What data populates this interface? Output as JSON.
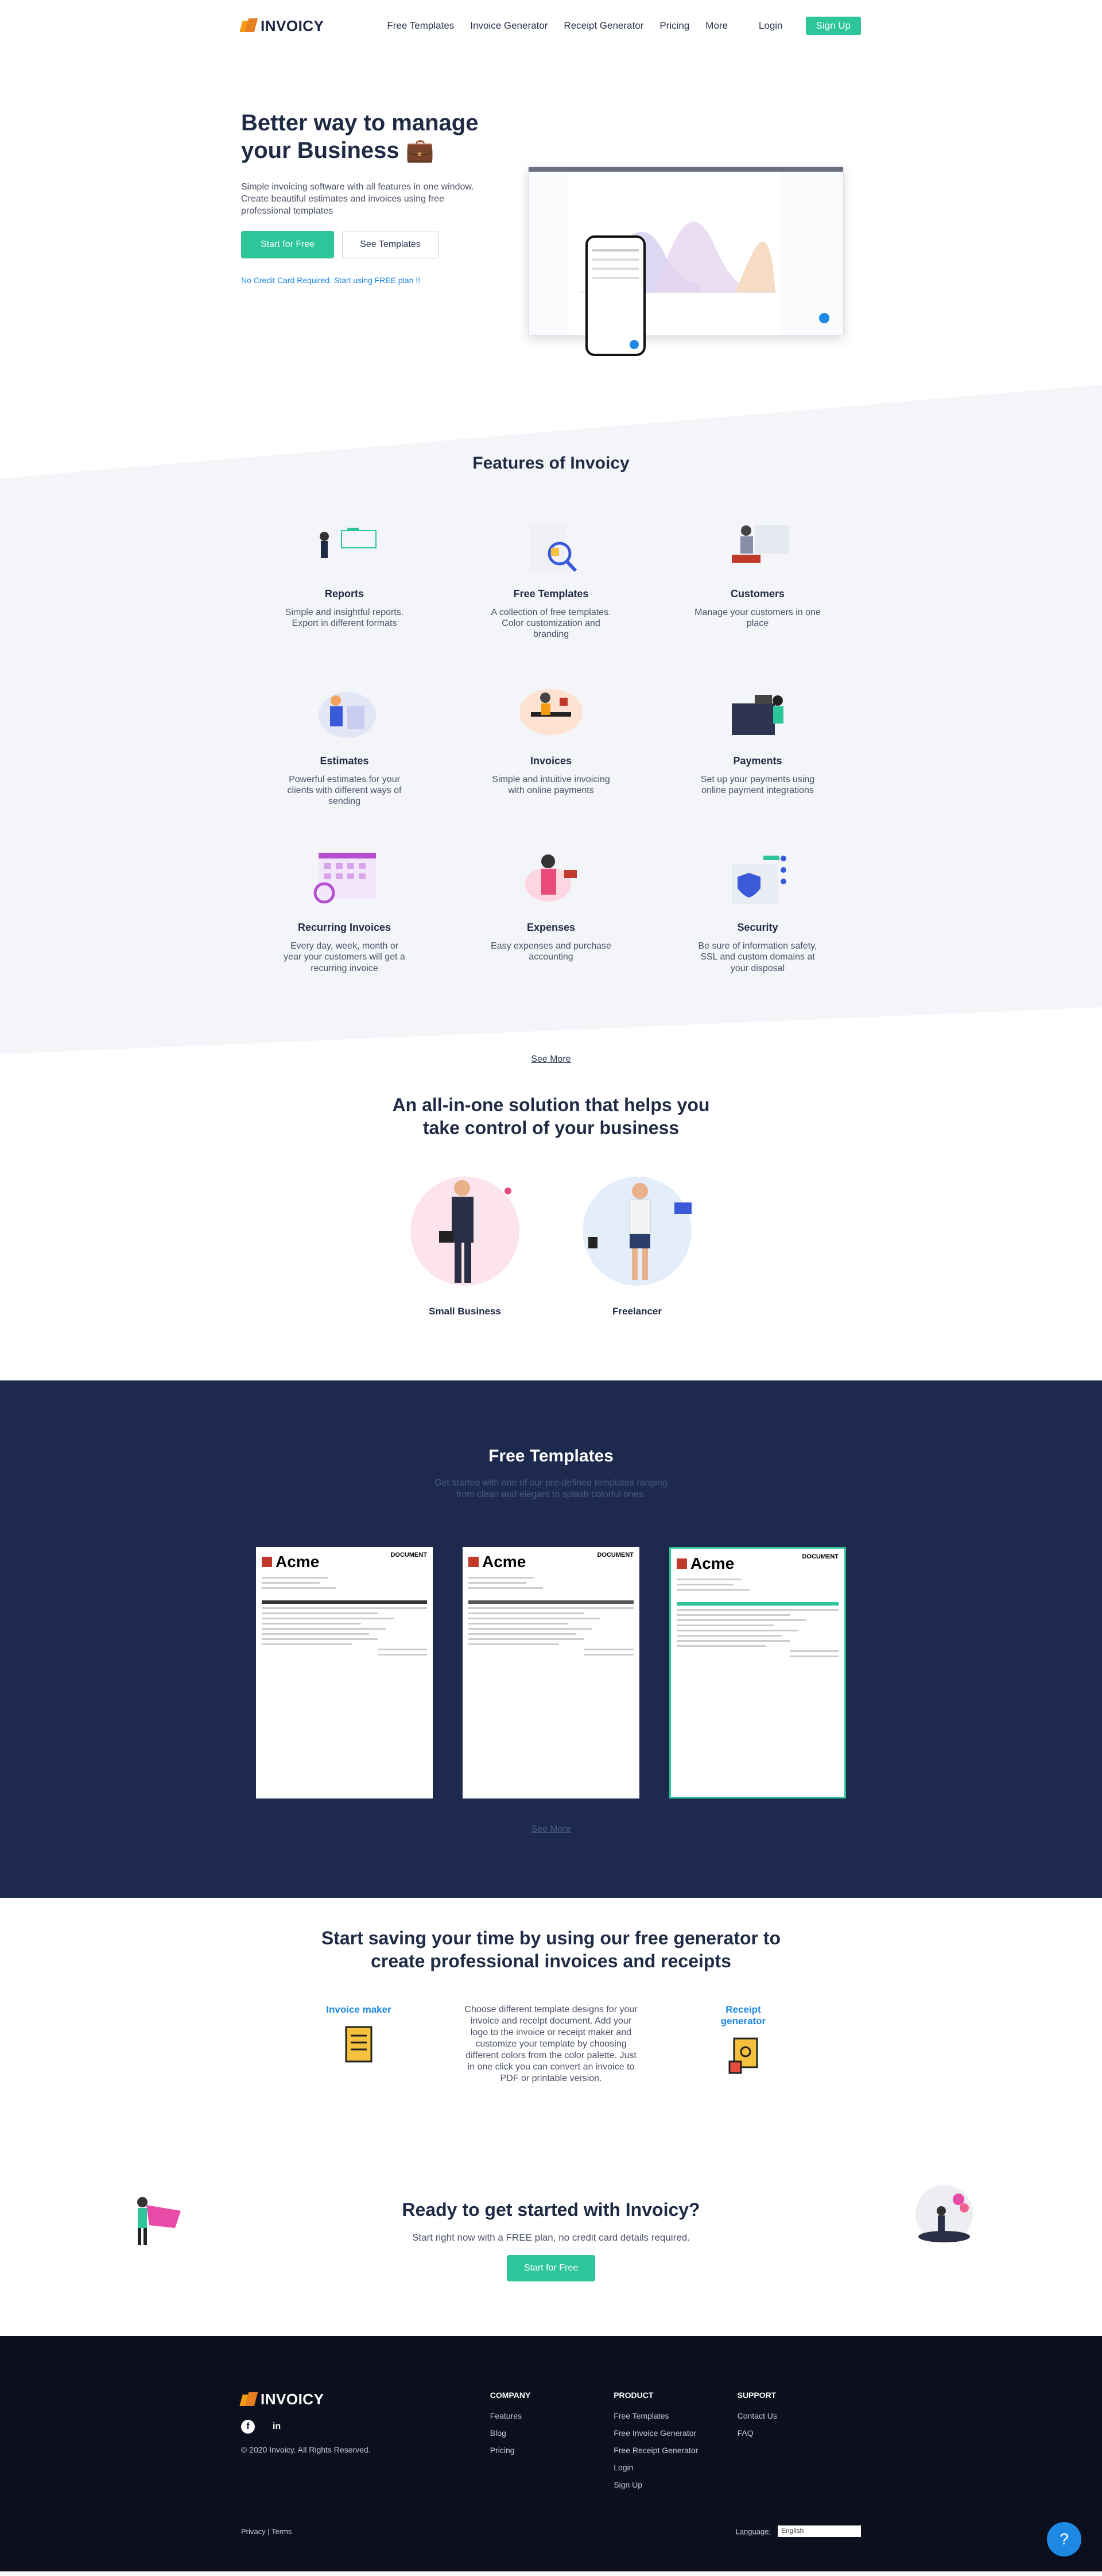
{
  "header": {
    "logo_text": "INVOICY",
    "nav": [
      "Free Templates",
      "Invoice Generator",
      "Receipt Generator",
      "Pricing",
      "More"
    ],
    "login": "Login",
    "signup": "Sign Up"
  },
  "hero": {
    "title": "Better way to manage your Business 💼",
    "subtitle": "Simple invoicing software with all features in one window. Create beautiful estimates and invoices using free professional templates",
    "cta_primary": "Start for Free",
    "cta_secondary": "See Templates",
    "note": "No Credit Card Required. Start using FREE plan !!"
  },
  "features": {
    "title": "Features of Invoicy",
    "items": [
      {
        "title": "Reports",
        "desc": "Simple and insightful reports. Export in different formats"
      },
      {
        "title": "Free Templates",
        "desc": "A collection of free templates. Color customization and branding"
      },
      {
        "title": "Customers",
        "desc": "Manage your customers in one place"
      },
      {
        "title": "Estimates",
        "desc": "Powerful estimates for your clients with different ways of sending"
      },
      {
        "title": "Invoices",
        "desc": "Simple and intuitive invoicing with online payments"
      },
      {
        "title": "Payments",
        "desc": "Set up your payments using online payment integrations"
      },
      {
        "title": "Recurring Invoices",
        "desc": "Every day, week, month or year your customers will get a recurring invoice"
      },
      {
        "title": "Expenses",
        "desc": "Easy expenses and purchase accounting"
      },
      {
        "title": "Security",
        "desc": "Be sure of information safety, SSL and custom domains at your disposal"
      }
    ],
    "see_more": "See More"
  },
  "aio": {
    "title": "An all-in-one solution that helps you take control of your business",
    "personas": [
      "Small Business",
      "Freelancer"
    ]
  },
  "templates": {
    "title": "Free Templates",
    "subtitle": "Get started with one of our pre-defined templates ranging from clean and elegant to splash colorful ones.",
    "brand": "Acme",
    "doc_label": "DOCUMENT",
    "see_more": "See More"
  },
  "save": {
    "title": "Start saving your time by using our free generator to create professional invoices and receipts",
    "invoice_maker": "Invoice maker",
    "receipt_generator": "Receipt generator",
    "desc": "Choose different template designs for your invoice and receipt document. Add your logo to the invoice or receipt maker and customize your template by choosing different colors from the color palette. Just in one click you can convert an invoice to PDF or printable version."
  },
  "cta": {
    "title": "Ready to get started with Invoicy?",
    "subtitle": "Start right now with a FREE plan, no credit card details required.",
    "button": "Start for Free"
  },
  "footer": {
    "logo_text": "INVOICY",
    "copyright": "© 2020 Invoicy. All Rights Reserved.",
    "company": {
      "title": "COMPANY",
      "links": [
        "Features",
        "Blog",
        "Pricing"
      ]
    },
    "product": {
      "title": "PRODUCT",
      "links": [
        "Free Templates",
        "Free Invoice Generator",
        "Free Receipt Generator",
        "Login",
        "Sign Up"
      ]
    },
    "support": {
      "title": "SUPPORT",
      "links": [
        "Contact Us",
        "FAQ"
      ]
    },
    "legal": "Privacy | Terms",
    "language_label": "Language:",
    "language_value": "English",
    "help": "?"
  },
  "colors": {
    "accent": "#2dc59a",
    "navy": "#1d2a4d",
    "link": "#1e88e5",
    "footer": "#0c0f1e"
  }
}
